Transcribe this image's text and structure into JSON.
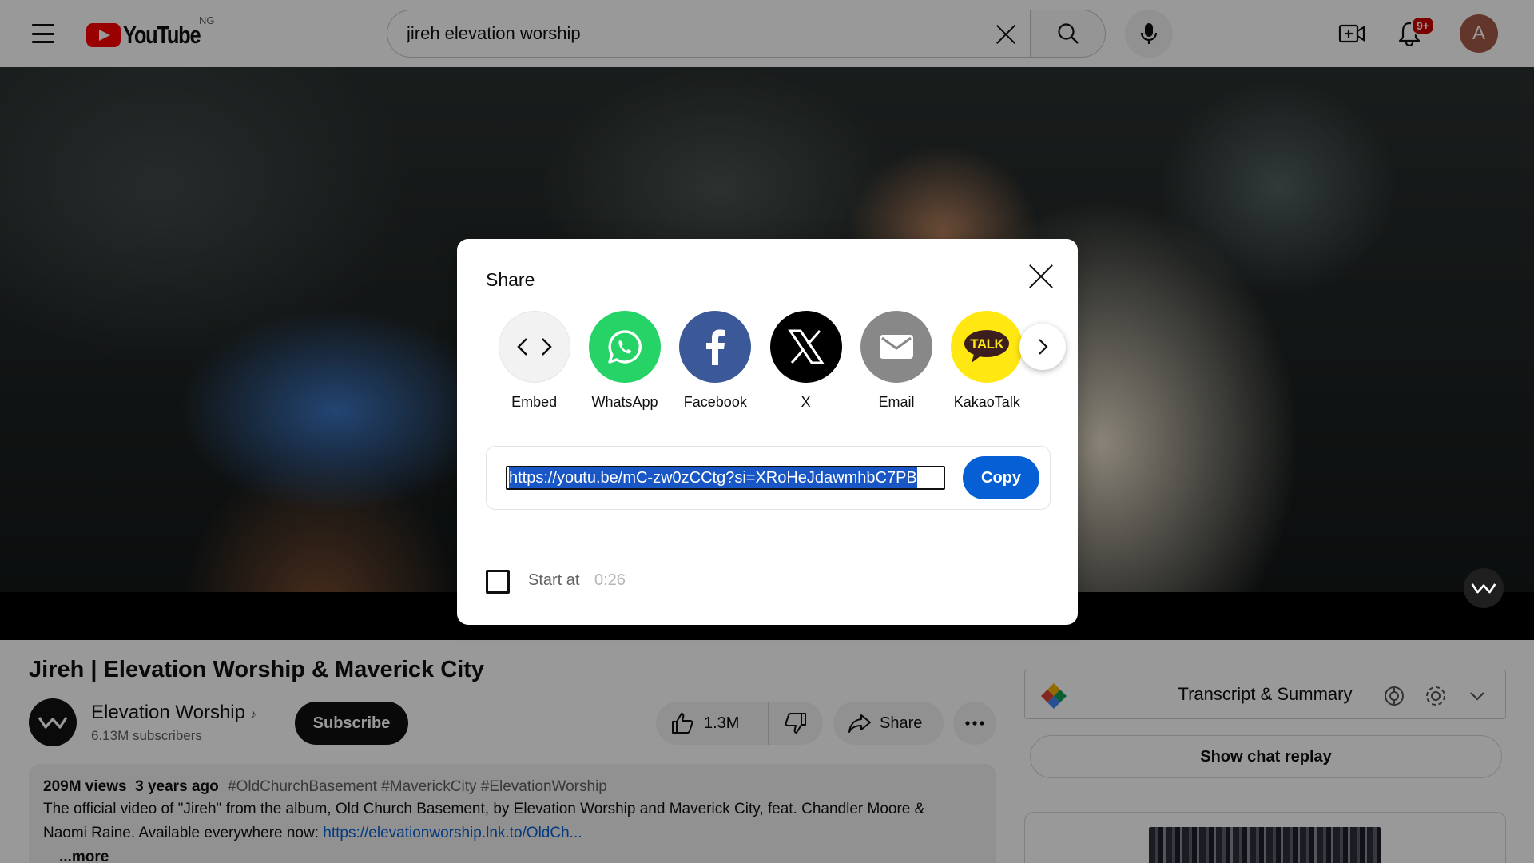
{
  "header": {
    "logo_text": "YouTube",
    "country_code": "NG",
    "search_value": "jireh elevation worship",
    "notification_badge": "9+",
    "avatar_letter": "A"
  },
  "video": {
    "title": "Jireh | Elevation Worship & Maverick City",
    "channel_name": "Elevation Worship",
    "channel_note": "♪",
    "subscribers": "6.13M subscribers",
    "subscribe_label": "Subscribe",
    "like_count": "1.3M",
    "share_label": "Share"
  },
  "description": {
    "views": "209M views",
    "age": "3 years ago",
    "hashtags": "#OldChurchBasement #MaverickCity #ElevationWorship",
    "text": "The official video of \"Jireh\" from the album, Old Church Basement, by Elevation Worship and Maverick City, feat. Chandler Moore & Naomi Raine. Available everywhere now: ",
    "link": "https://elevationworship.lnk.to/OldCh...",
    "more_label": "...more"
  },
  "sidebar": {
    "transcript_title": "Transcript & Summary",
    "chat_replay_label": "Show chat replay"
  },
  "share_dialog": {
    "title": "Share",
    "targets": [
      {
        "label": "Embed",
        "icon": "embed-code-icon",
        "color": "#f2f2f2"
      },
      {
        "label": "WhatsApp",
        "icon": "whatsapp-icon",
        "color": "#25d366"
      },
      {
        "label": "Facebook",
        "icon": "facebook-icon",
        "color": "#3b5998"
      },
      {
        "label": "X",
        "icon": "x-icon",
        "color": "#000000"
      },
      {
        "label": "Email",
        "icon": "email-icon",
        "color": "#888888"
      },
      {
        "label": "KakaoTalk",
        "icon": "kakaotalk-icon",
        "color": "#ffe812"
      }
    ],
    "kakao_badge_text": "TALK",
    "url": "https://youtu.be/mC-zw0zCCtg?si=XRoHeJdawmhbC7PB",
    "copy_label": "Copy",
    "start_at_label": "Start at",
    "start_at_time": "0:26",
    "start_at_checked": false
  },
  "colors": {
    "brand_red": "#ff0000",
    "link_blue": "#065fd4",
    "selection_blue": "#1a57c6"
  }
}
